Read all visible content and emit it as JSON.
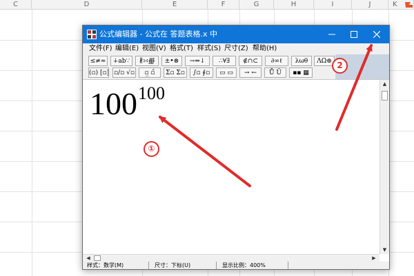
{
  "spreadsheet": {
    "columns": [
      "C",
      "D",
      "E",
      "F",
      "G",
      "H",
      "I",
      "J",
      "K"
    ]
  },
  "window": {
    "title": "公式编辑器 - 公式在 答题表格.x 中",
    "controls": {
      "minimize": "minimize-icon",
      "maximize": "maximize-icon",
      "close": "close-icon"
    }
  },
  "menu": [
    "文件(F)",
    "编辑(E)",
    "视图(V)",
    "格式(T)",
    "样式(S)",
    "尺寸(Z)",
    "帮助(H)"
  ],
  "toolbar": {
    "row1": [
      "≤≠≈",
      "∔ab∵",
      "∦∺∰",
      "±•⊗",
      "→⇔↓",
      "∴∀∃",
      "∉∩⊂",
      "∂∞ℓ",
      "λωθ",
      "ΛΩ⊛"
    ],
    "row2": [
      "(▫) [▫]",
      "▫/▫ √▫",
      "▫̲ ▫̂",
      "Σ▫ Σ▫",
      "∫▫ ∮▫",
      "▭ ▭",
      "→ ←",
      "Ů Ŭ",
      "▪▪ ▦"
    ]
  },
  "equation": {
    "base": "100",
    "superscript": "100"
  },
  "status": {
    "style": "样式：数学(M)",
    "size": "尺寸：下标(U)",
    "zoom": "显示比例：400%"
  },
  "annotations": {
    "labels": [
      "①",
      "2"
    ],
    "color": "#e02b2b"
  }
}
